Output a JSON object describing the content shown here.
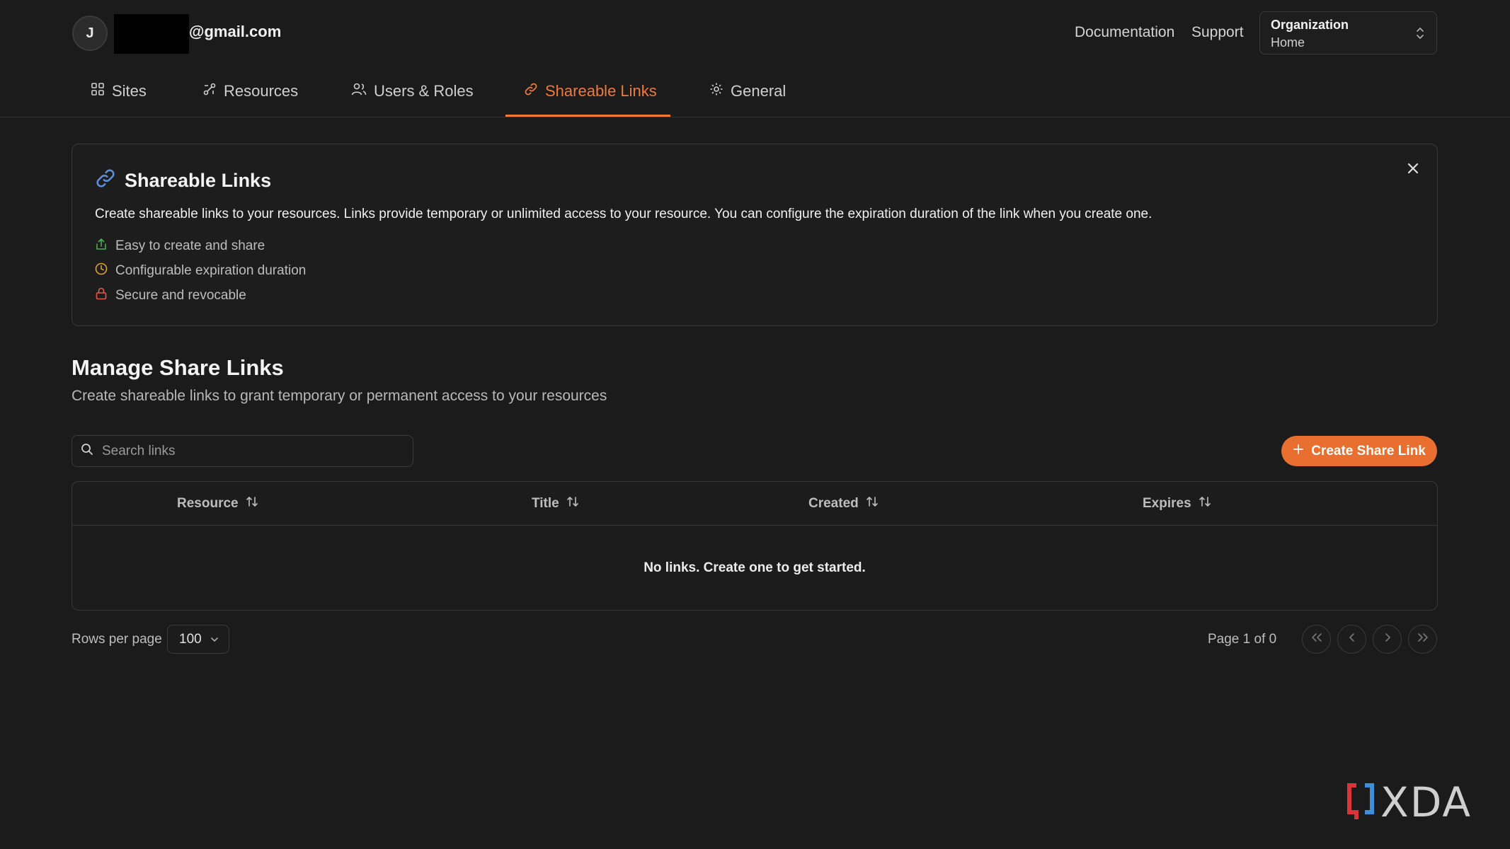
{
  "user": {
    "avatar_initial": "J",
    "email_domain": "@gmail.com"
  },
  "header": {
    "documentation": "Documentation",
    "support": "Support",
    "org_label": "Organization",
    "org_value": "Home"
  },
  "tabs": [
    {
      "label": "Sites",
      "icon": "sites-icon"
    },
    {
      "label": "Resources",
      "icon": "resources-icon"
    },
    {
      "label": "Users & Roles",
      "icon": "users-icon"
    },
    {
      "label": "Shareable Links",
      "icon": "link-icon",
      "active": true
    },
    {
      "label": "General",
      "icon": "gear-icon"
    }
  ],
  "info": {
    "title": "Shareable Links",
    "description": "Create shareable links to your resources. Links provide temporary or unlimited access to your resource. You can configure the expiration duration of the link when you create one.",
    "features": [
      {
        "label": "Easy to create and share",
        "icon": "share-icon",
        "color": "#4caf50"
      },
      {
        "label": "Configurable expiration duration",
        "icon": "clock-icon",
        "color": "#e0a030"
      },
      {
        "label": "Secure and revocable",
        "icon": "lock-icon",
        "color": "#e05a4a"
      }
    ]
  },
  "section": {
    "title": "Manage Share Links",
    "subtitle": "Create shareable links to grant temporary or permanent access to your resources"
  },
  "search": {
    "placeholder": "Search links",
    "value": ""
  },
  "create_button": "Create Share Link",
  "table": {
    "columns": [
      "Resource",
      "Title",
      "Created",
      "Expires"
    ],
    "empty_message": "No links. Create one to get started."
  },
  "pagination": {
    "rows_label": "Rows per page",
    "rows_value": "100",
    "page_info": "Page 1 of 0"
  },
  "watermark": "XDA",
  "colors": {
    "accent": "#e86f2f",
    "background": "#1b1b1b"
  }
}
